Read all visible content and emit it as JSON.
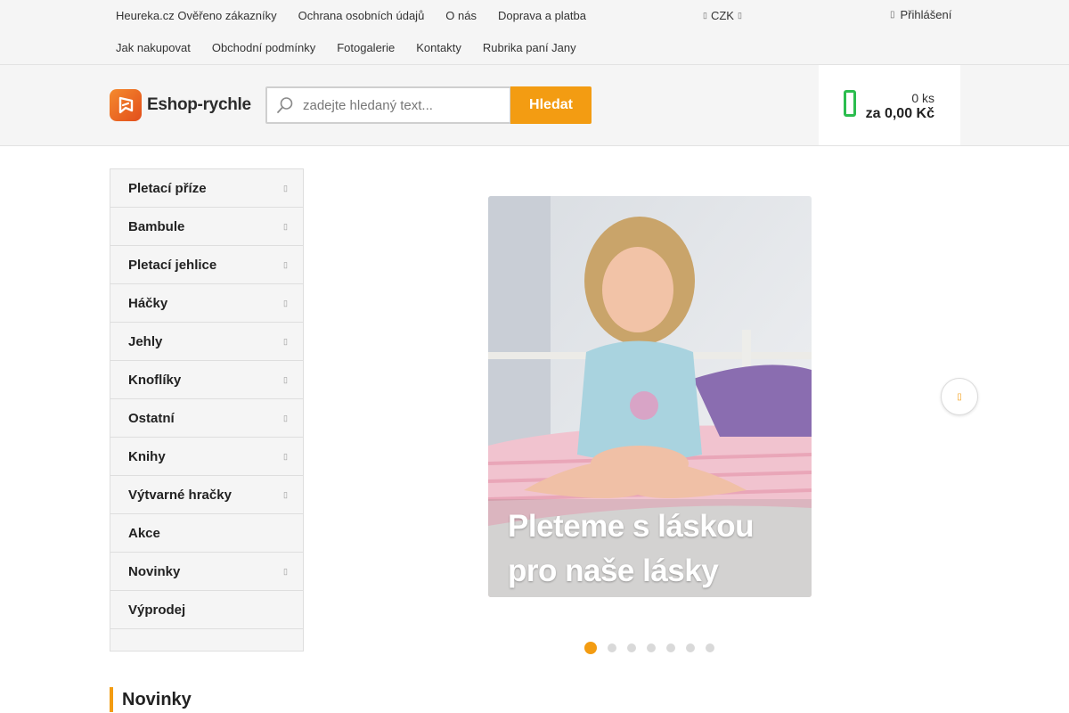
{
  "top_links": [
    "Heureka.cz Ověřeno zákazníky",
    "Ochrana osobních údajů",
    "O nás",
    "Doprava a platba",
    "Jak nakupovat",
    "Obchodní podmínky",
    "Fotogalerie",
    "Kontakty",
    "Rubrika paní Jany"
  ],
  "currency": {
    "label": "CZK",
    "icon": "chevron-down-icon"
  },
  "login": {
    "label": "Přihlášení",
    "icon": "user-icon"
  },
  "logo": {
    "text": "Eshop-rychle",
    "icon": "eshop-logo-icon"
  },
  "search": {
    "placeholder": "zadejte hledaný text...",
    "button": "Hledat",
    "icon": "search-icon"
  },
  "cart": {
    "qty": "0 ks",
    "price": "za 0,00 Kč",
    "icon": "cart-icon"
  },
  "categories": [
    {
      "label": "Pletací příze",
      "has_sub": true
    },
    {
      "label": "Bambule",
      "has_sub": true
    },
    {
      "label": "Pletací jehlice",
      "has_sub": true
    },
    {
      "label": "Háčky",
      "has_sub": true
    },
    {
      "label": "Jehly",
      "has_sub": true
    },
    {
      "label": "Knoflíky",
      "has_sub": true
    },
    {
      "label": "Ostatní",
      "has_sub": true
    },
    {
      "label": "Knihy",
      "has_sub": true
    },
    {
      "label": "Výtvarné hračky",
      "has_sub": true
    },
    {
      "label": "Akce",
      "has_sub": false
    },
    {
      "label": "Novinky",
      "has_sub": true
    },
    {
      "label": "Výprodej",
      "has_sub": false
    }
  ],
  "banner": {
    "caption_line1": "Pleteme s láskou",
    "caption_line2": "pro naše lásky",
    "slide_count": 7,
    "active_slide": 1
  },
  "section": {
    "title": "Novinky"
  },
  "colors": {
    "accent": "#f39c12",
    "cart": "#2bbd4e"
  }
}
